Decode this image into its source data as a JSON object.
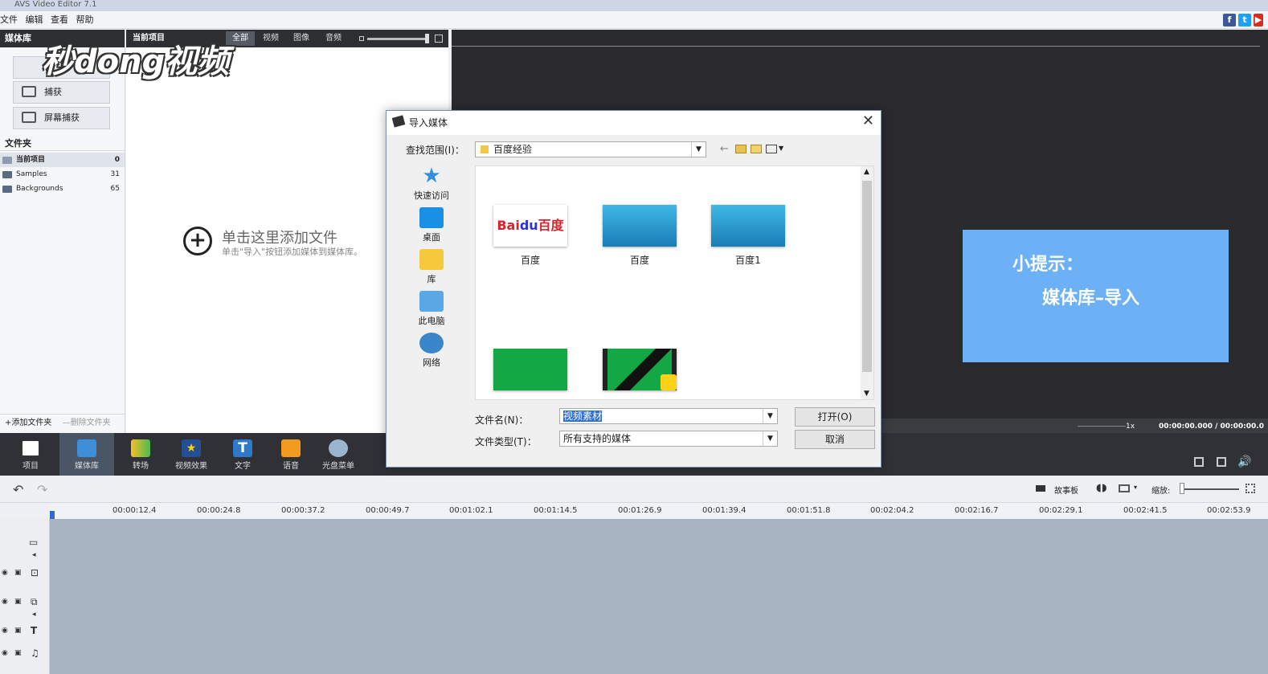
{
  "window": {
    "title": "AVS Video Editor 7.1"
  },
  "menu": [
    "文件",
    "编辑",
    "查看",
    "帮助"
  ],
  "social": [
    "f",
    "t",
    "▶"
  ],
  "media_panel": {
    "header": "媒体库",
    "capture_label": "捕获",
    "screen_capture_label": "屏幕捕获",
    "folders_header": "文件夹",
    "folders": [
      {
        "name": "当前项目",
        "count": "0"
      },
      {
        "name": "Samples",
        "count": "31"
      },
      {
        "name": "Backgrounds",
        "count": "65"
      }
    ],
    "add_folder": "添加文件夹",
    "delete_folder": "删除文件夹"
  },
  "center": {
    "header": "当前项目",
    "tabs": [
      "全部",
      "视频",
      "图像",
      "音频"
    ],
    "add_title": "单击这里添加文件",
    "add_hint": "单击\"导入\"按钮添加媒体到媒体库。"
  },
  "preview": {
    "tip_line1": "小提示：",
    "tip_line2": "媒体库–导入",
    "speed": "1x",
    "time": "00:00:00.000 / 00:00:00.0"
  },
  "toolbar": [
    "项目",
    "媒体库",
    "转场",
    "视频效果",
    "文字",
    "语音",
    "光盘菜单"
  ],
  "timeline": {
    "storyboard": "故事板",
    "zoom_label": "缩放:",
    "ticks": [
      "00:00:12.4",
      "00:00:24.8",
      "00:00:37.2",
      "00:00:49.7",
      "00:01:02.1",
      "00:01:14.5",
      "00:01:26.9",
      "00:01:39.4",
      "00:01:51.8",
      "00:02:04.2",
      "00:02:16.7",
      "00:02:29.1",
      "00:02:41.5",
      "00:02:53.9"
    ]
  },
  "dialog": {
    "title": "导入媒体",
    "look_in_label": "查找范围(I)：",
    "look_in_value": "百度经验",
    "places": [
      "快速访问",
      "桌面",
      "库",
      "此电脑",
      "网络"
    ],
    "files": [
      {
        "name": "百度"
      },
      {
        "name": "百度"
      },
      {
        "name": "百度1"
      },
      {
        "name": ""
      },
      {
        "name": ""
      }
    ],
    "filename_label": "文件名(N)：",
    "filename_value": "视频素材",
    "filetype_label": "文件类型(T)：",
    "filetype_value": "所有支持的媒体",
    "open_button": "打开(O)",
    "cancel_button": "取消"
  },
  "watermark": "秒懂视频",
  "colors": {
    "accent": "#6cb0f5",
    "dark": "#2d2f33",
    "track": "#a7b4c2"
  }
}
